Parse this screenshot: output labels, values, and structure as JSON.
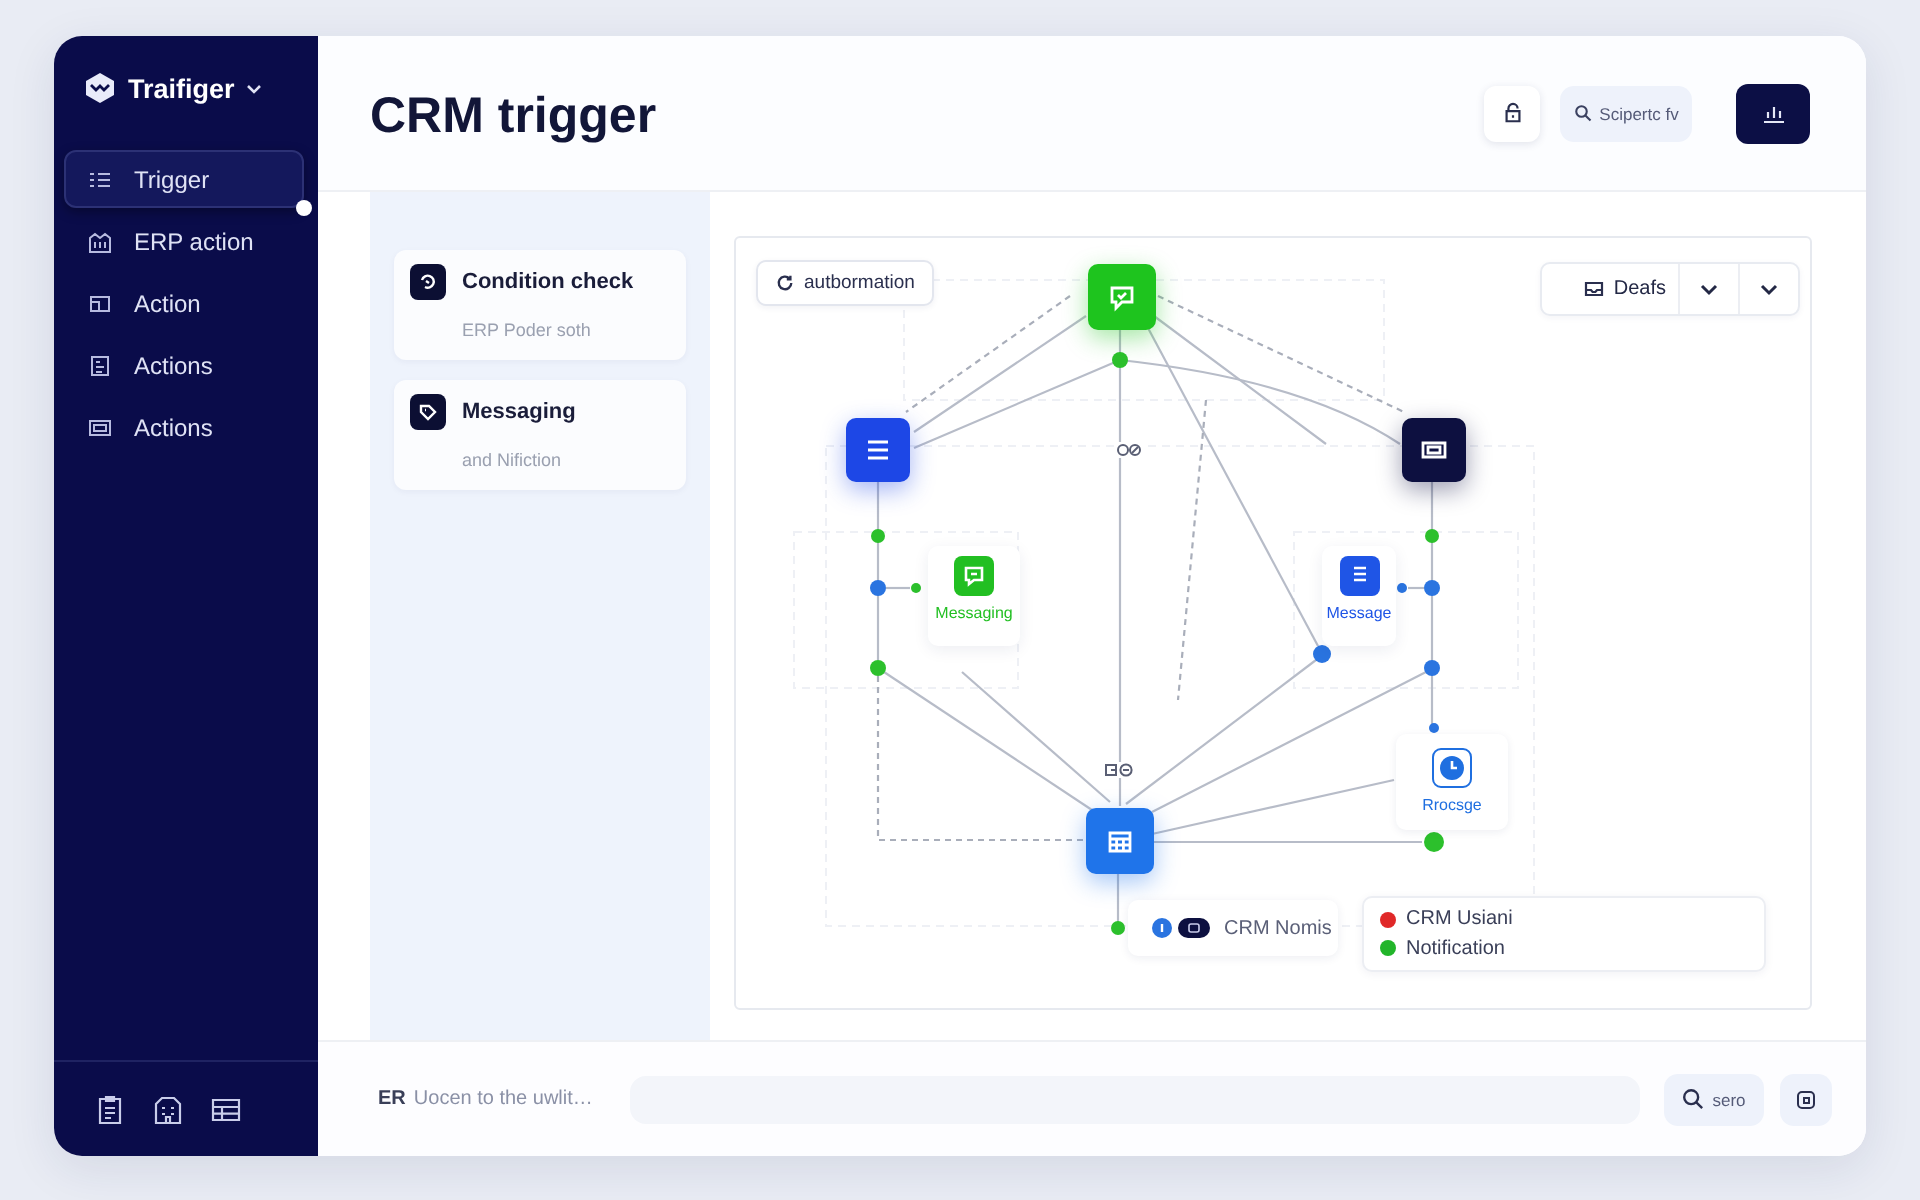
{
  "sidebar": {
    "brand": "Traifiger",
    "items": [
      {
        "label": "Trigger",
        "selected": true
      },
      {
        "label": "ERP action",
        "selected": false
      },
      {
        "label": "Action",
        "selected": false
      },
      {
        "label": "Actions",
        "selected": false
      },
      {
        "label": "Actions",
        "selected": false
      }
    ]
  },
  "header": {
    "title": "CRM trigger",
    "search_button": "Scipertc fv"
  },
  "library": [
    {
      "title": "Condition check",
      "subtitle": "ERP Poder soth"
    },
    {
      "title": "Messaging",
      "subtitle": "and Nifiction"
    }
  ],
  "canvas": {
    "chip": "autbormation",
    "view_select": "Deafs",
    "nodes": [
      {
        "color": "#1ec41e"
      },
      {
        "color": "#1d47e6"
      },
      {
        "color": "#0d1040"
      },
      {
        "color": "#1f74ea"
      }
    ],
    "cards": [
      {
        "label": "Messaging",
        "kind": "filled",
        "color": "#22bf22"
      },
      {
        "label": "Message",
        "kind": "filled",
        "color": "#1f55e6"
      },
      {
        "label": "Rrocsge",
        "kind": "outlined",
        "color": "#1f6fe0"
      }
    ],
    "link_chip": "CRM Nomis",
    "legend": [
      {
        "label": "CRM Usiani",
        "color": "#e02828"
      },
      {
        "label": "Notification",
        "color": "#22b52a"
      }
    ]
  },
  "footer": {
    "prefix": "ER",
    "status": "Uocen to the uwlit…",
    "search_button": "sero"
  }
}
